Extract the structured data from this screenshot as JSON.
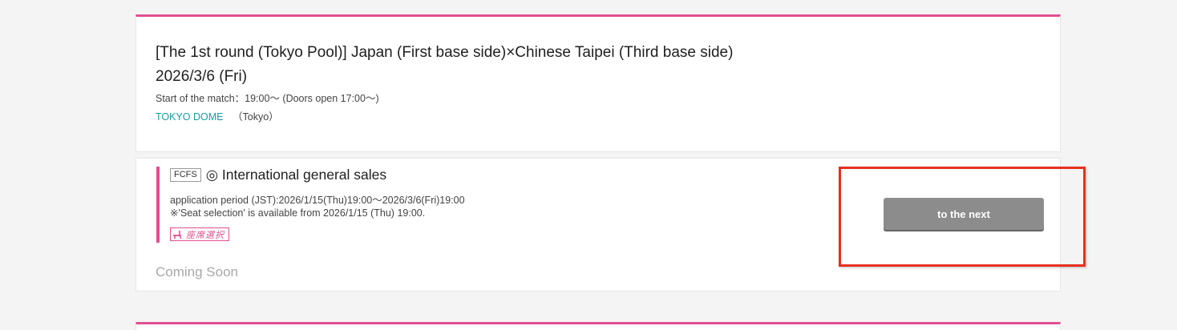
{
  "event": {
    "title": "[The 1st round (Tokyo Pool)] Japan (First base side)×Chinese Taipei (Third base side)",
    "date": "2026/3/6 (Fri)",
    "start_info": "Start of the match：19:00～ (Doors open 17:00～)",
    "venue_name": "TOKYO DOME",
    "venue_location": "（Tokyo）"
  },
  "sale": {
    "badge": "FCFS",
    "title": "◎ International general sales",
    "application_period": "application period (JST):2026/1/15(Thu)19:00～2026/3/6(Fri)19:00",
    "seat_note": "※'Seat selection' is available from 2026/1/15 (Thu) 19:00.",
    "seat_badge_text": "座席選択",
    "status": "Coming Soon",
    "next_button_label": "to the next"
  },
  "icons": {
    "seat_selection": "chair-icon"
  },
  "colors": {
    "accent_pink": "#e0508f",
    "link_teal": "#1a9aa8",
    "button_gray": "#8c8c8c",
    "highlight_red": "#e8301e",
    "status_gray": "#a8a8a8"
  }
}
